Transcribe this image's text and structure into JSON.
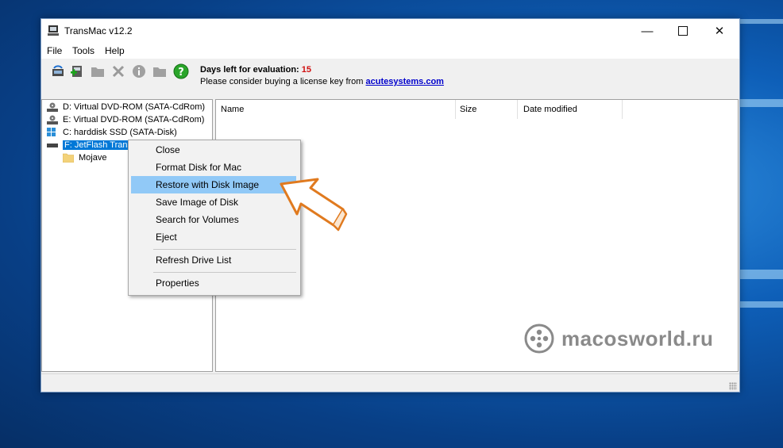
{
  "window": {
    "title": "TransMac v12.2",
    "controls": {
      "minimize": "—",
      "close": "✕"
    }
  },
  "menu": [
    "File",
    "Tools",
    "Help"
  ],
  "toolbar": {
    "icons": [
      "refresh-drives-icon",
      "add-disk-icon",
      "open-folder-icon",
      "delete-icon",
      "info-icon",
      "new-folder-icon",
      "help-icon"
    ],
    "evaluation_label": "Days left for evaluation:",
    "evaluation_days": "15",
    "license_text": "Please consider buying a license key from",
    "license_link": "acutesystems.com"
  },
  "tree": [
    {
      "label": "D:  Virtual DVD-ROM (SATA-CdRom)",
      "icon": "cdrom-drive-icon"
    },
    {
      "label": "E:  Virtual DVD-ROM (SATA-CdRom)",
      "icon": "cdrom-drive-icon"
    },
    {
      "label": "C:  harddisk  SSD (SATA-Disk)",
      "icon": "hard-disk-icon"
    },
    {
      "label": "F: JetFlash Transc",
      "icon": "usb-drive-icon"
    },
    {
      "label": "Mojave",
      "icon": "folder-icon"
    }
  ],
  "columns": [
    "Name",
    "Size",
    "Date modified"
  ],
  "context_menu": [
    {
      "label": "Close"
    },
    {
      "label": "Format Disk for Mac"
    },
    {
      "label": "Restore with Disk Image",
      "highlighted": true
    },
    {
      "label": "Save Image of Disk"
    },
    {
      "label": "Search for Volumes"
    },
    {
      "label": "Eject"
    },
    {
      "label": "Refresh Drive List"
    },
    {
      "label": "Properties"
    }
  ],
  "watermark": "macosworld.ru",
  "colors": {
    "accent": "#0078d7",
    "highlight": "#91c9f7",
    "arrow": "#e07a1f",
    "evaluation_days": "#d01010"
  }
}
